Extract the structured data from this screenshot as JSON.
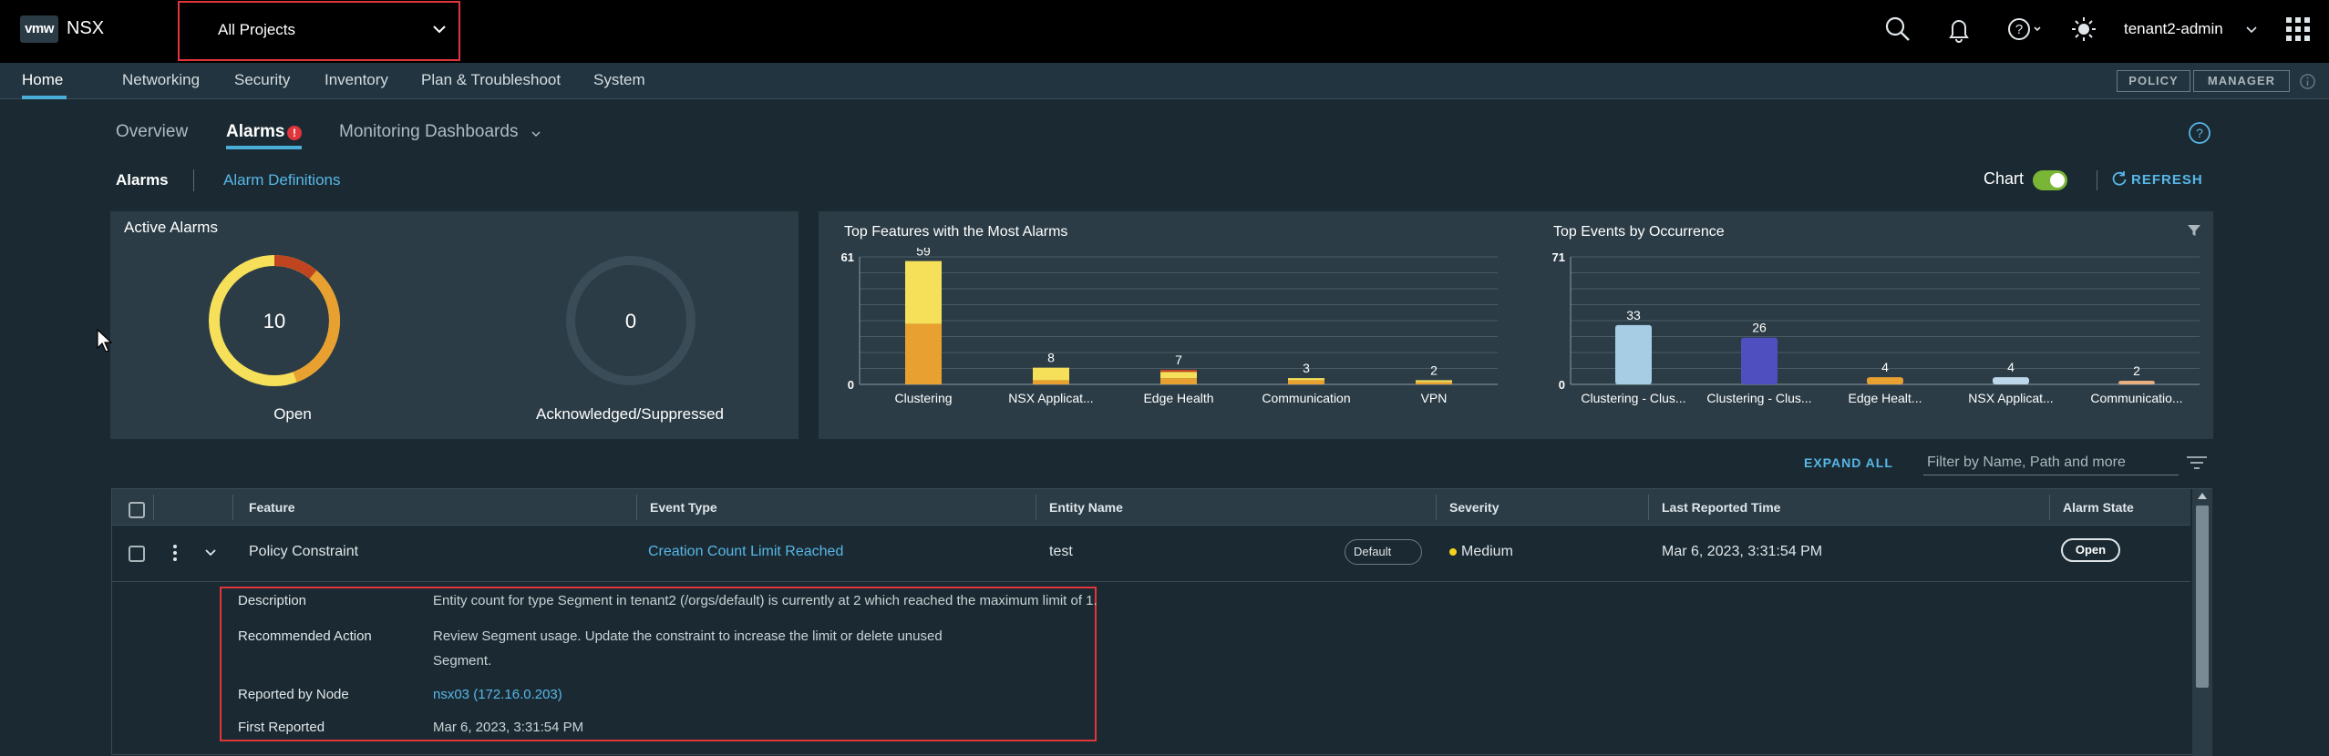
{
  "header": {
    "logo": "vmw",
    "product": "NSX",
    "project_select": "All Projects",
    "user": "tenant2-admin"
  },
  "nav": {
    "items": [
      "Home",
      "Networking",
      "Security",
      "Inventory",
      "Plan & Troubleshoot",
      "System"
    ],
    "active": "Home",
    "mode_policy": "POLICY",
    "mode_manager": "MANAGER"
  },
  "tabs": {
    "overview": "Overview",
    "alarms": "Alarms",
    "alarm_badge": "!",
    "monitoring": "Monitoring Dashboards"
  },
  "subnav": {
    "alarms": "Alarms",
    "alarm_definitions": "Alarm Definitions",
    "chart_label": "Chart",
    "chart_enabled": true,
    "refresh": "REFRESH"
  },
  "active_alarms": {
    "title": "Active Alarms",
    "open_count": "10",
    "open_label": "Open",
    "ack_count": "0",
    "ack_label": "Acknowledged/Suppressed"
  },
  "chart_data": [
    {
      "type": "bar",
      "title": "Top Features with the Most Alarms",
      "categories": [
        "Clustering",
        "NSX Applicat...",
        "Edge Health",
        "Communication",
        "VPN"
      ],
      "values": [
        59,
        8,
        7,
        3,
        2
      ],
      "ylim": [
        0,
        61
      ],
      "yticks": [
        "0",
        "61"
      ],
      "grid": true,
      "stacked_segments": [
        {
          "color": "#e8a030",
          "values": [
            29,
            2,
            3,
            2,
            1
          ]
        },
        {
          "color": "#f6e05a",
          "values": [
            30,
            6,
            3,
            1,
            1
          ]
        },
        {
          "color": "#c0441f",
          "values": [
            0,
            0,
            1,
            0,
            0
          ]
        }
      ]
    },
    {
      "type": "bar",
      "title": "Top Events by Occurrence",
      "categories": [
        "Clustering - Clus...",
        "Clustering - Clus...",
        "Edge Healt...",
        "NSX Applicat...",
        "Communicatio..."
      ],
      "values": [
        33,
        26,
        4,
        4,
        2
      ],
      "ylim": [
        0,
        71
      ],
      "yticks": [
        "0",
        "71"
      ],
      "grid": true,
      "colors": [
        "#a6cde4",
        "#4f4fbf",
        "#e8a030",
        "#bcd6ea",
        "#e8b080"
      ]
    }
  ],
  "table": {
    "expand_all": "EXPAND ALL",
    "filter_placeholder": "Filter by Name, Path and more",
    "headers": [
      "Feature",
      "Event Type",
      "Entity Name",
      "Severity",
      "Last Reported Time",
      "Alarm State"
    ],
    "row": {
      "feature": "Policy Constraint",
      "event_type": "Creation Count Limit Reached",
      "entity_name": "test",
      "entity_badge": "Default",
      "severity": "Medium",
      "last_reported": "Mar 6, 2023, 3:31:54 PM",
      "state": "Open"
    },
    "details": {
      "description_label": "Description",
      "description": "Entity count for type Segment in tenant2 (/orgs/default) is currently at 2 which reached the maximum limit of 1.",
      "recommended_label": "Recommended Action",
      "recommended_line1": "Review Segment usage. Update the constraint to increase the limit or delete unused",
      "recommended_line2": "Segment.",
      "node_label": "Reported by Node",
      "node": "nsx03 (172.16.0.203)",
      "first_label": "First Reported",
      "first": "Mar 6, 2023, 3:31:54 PM"
    }
  }
}
